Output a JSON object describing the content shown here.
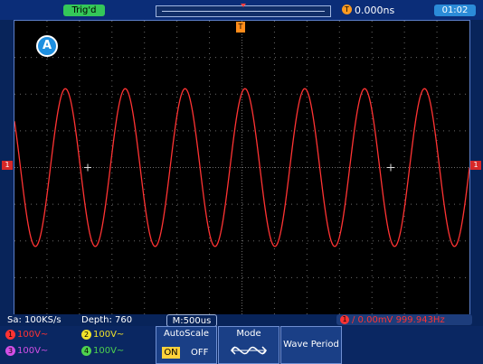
{
  "topbar": {
    "trig_status": "Trig'd",
    "trigger_time": "0.000ns",
    "clock": "01:02"
  },
  "auto_icon": "A",
  "markers": {
    "ch1_left": "1",
    "ch1_right": "1",
    "trigger_top": "T"
  },
  "status": {
    "sample_rate": "Sa: 100KS/s",
    "depth": "Depth: 760",
    "timebase": "M:500us",
    "trigger": {
      "channel": "1",
      "text": "/ 0.00mV  999.943Hz"
    }
  },
  "channels": [
    {
      "num": "1",
      "label": "100V~",
      "color": "#ff3333"
    },
    {
      "num": "2",
      "label": "100V~",
      "color": "#f2e32a"
    },
    {
      "num": "3",
      "label": "100V~",
      "color": "#d34fe6"
    },
    {
      "num": "4",
      "label": "100V~",
      "color": "#4ed14e"
    }
  ],
  "buttons": {
    "autoscale": {
      "title": "AutoScale",
      "on": "ON",
      "off": "OFF"
    },
    "mode": {
      "title": "Mode"
    },
    "wave_period": "Wave Period"
  },
  "waveform": {
    "color": "#ff3333",
    "cycles_on_screen": 7.6,
    "amplitude_divisions": 2.15,
    "phase_at_left": 0.8
  }
}
